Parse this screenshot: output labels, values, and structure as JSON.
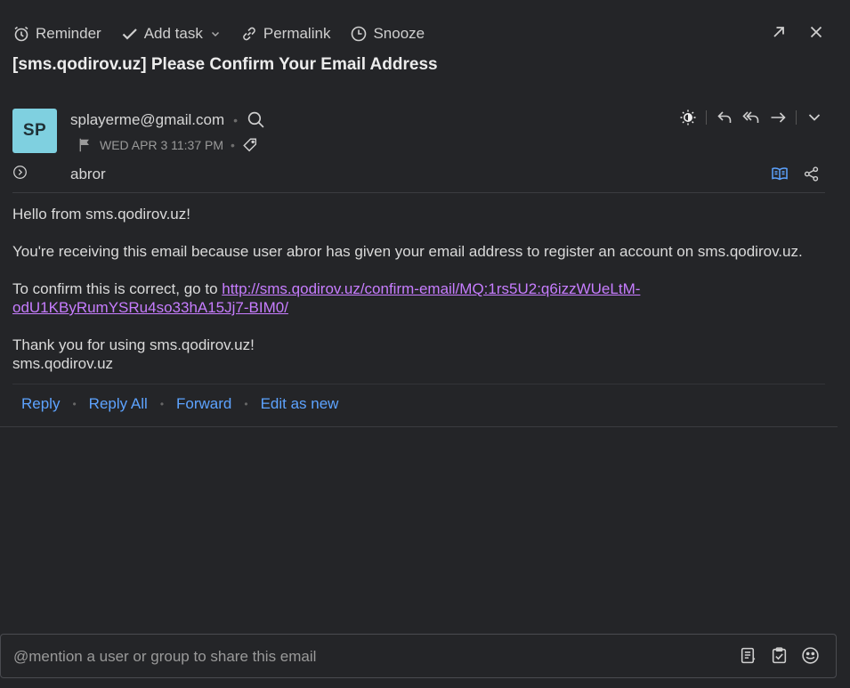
{
  "toolbar": {
    "reminder": "Reminder",
    "add_task": "Add task",
    "permalink": "Permalink",
    "snooze": "Snooze"
  },
  "subject": "[sms.qodirov.uz] Please Confirm Your Email Address",
  "header": {
    "avatar_initials": "SP",
    "avatar_color": "#7fd0e0",
    "from": "splayerme@gmail.com",
    "date": "WED APR 3 11:37 PM",
    "to": "abror"
  },
  "message": {
    "greeting": "Hello from sms.qodirov.uz!",
    "reason": "You're receiving this email because user abror has given your email address to register an account on sms.qodirov.uz.",
    "confirm_prefix": "To confirm this is correct, go to ",
    "confirm_link": "http://sms.qodirov.uz/confirm-email/MQ:1rs5U2:q6izzWUeLtM-odU1KByRumYSRu4so33hA15Jj7-BIM0/",
    "thanks": "Thank you for using sms.qodirov.uz!",
    "signature": "sms.qodirov.uz"
  },
  "actions": {
    "reply": "Reply",
    "reply_all": "Reply All",
    "forward": "Forward",
    "edit_as_new": "Edit as new"
  },
  "compose": {
    "placeholder": "@mention a user or group to share this email"
  },
  "colors": {
    "background": "#242528",
    "link": "#c77dff",
    "action": "#5da3ff"
  }
}
